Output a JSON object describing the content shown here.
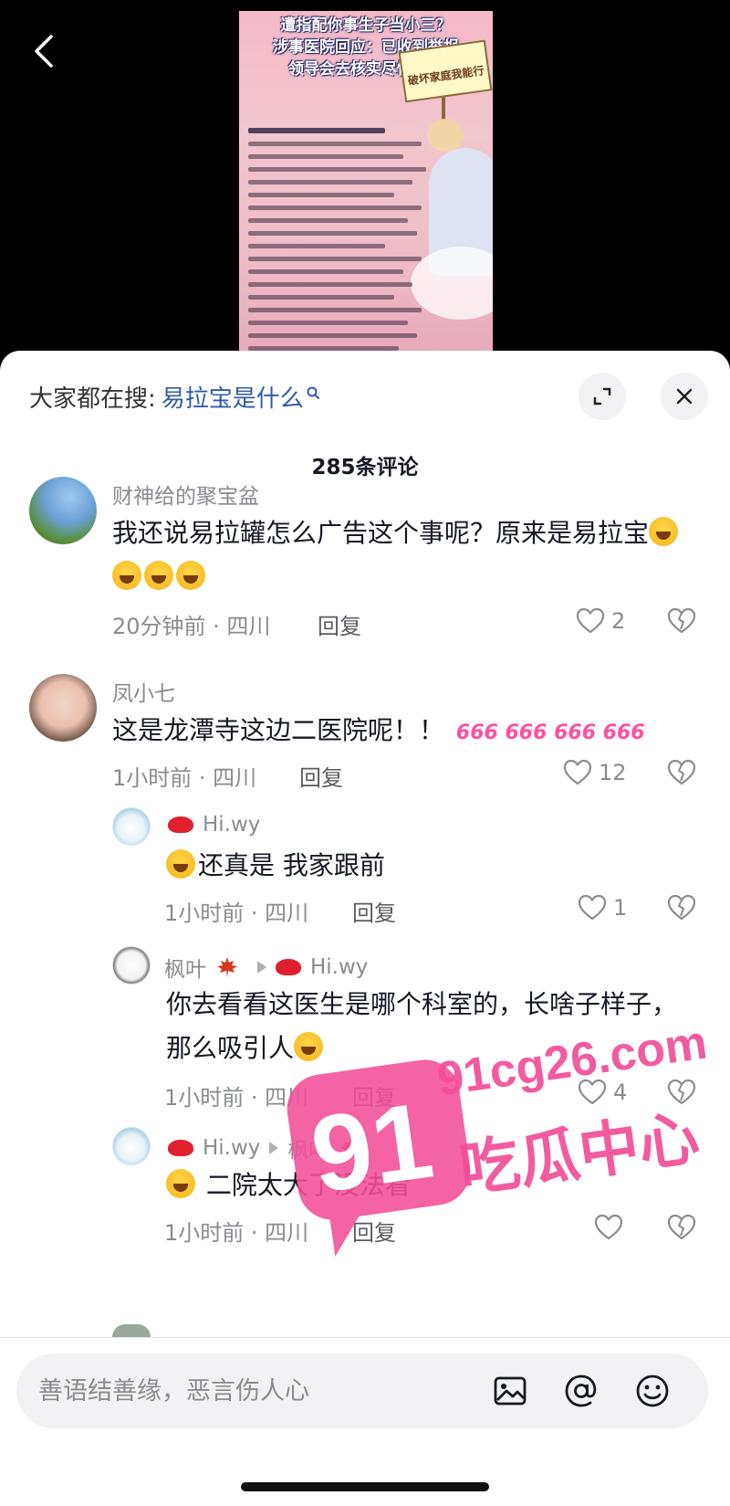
{
  "video": {
    "headline_lines": [
      "遭指配你事生子当小三？",
      "涉事医院回应：已收到举报",
      "领导会去核实尽快处理"
    ],
    "sign_text": "破坏家庭我能行"
  },
  "search_suggest": {
    "prefix": "大家都在搜:",
    "term": "易拉宝是什么"
  },
  "comment_count": "285条评论",
  "comments": [
    {
      "user": "财神给的聚宝盆",
      "text": "我还说易拉罐怎么广告这个事呢？原来是易拉宝",
      "time": "20分钟前 · 四川",
      "reply": "回复",
      "likes": "2"
    },
    {
      "user": "凤小七",
      "text": "这是龙潭寺这边二医院呢！！",
      "emoji_text": "666 666 666 666",
      "time": "1小时前 · 四川",
      "reply": "回复",
      "likes": "12"
    },
    {
      "user": "Hi.wy",
      "text": "还真是 我家跟前",
      "time": "1小时前 · 四川",
      "reply": "回复",
      "likes": "1"
    },
    {
      "user": "枫叶",
      "reply_to": "Hi.wy",
      "text": "你去看看这医生是哪个科室的，长啥子样子，那么吸引人",
      "time": "1小时前 · 四川",
      "reply": "回复",
      "likes": "4"
    },
    {
      "user": "Hi.wy",
      "reply_to": "枫叶",
      "text": "二院太大了没法看",
      "time": "1小时前 · 四川",
      "reply": "回复",
      "likes": ""
    }
  ],
  "watermark": {
    "big": "91",
    "domain": "91cg26.com",
    "cn": "吃瓜中心"
  },
  "input": {
    "placeholder": "善语结善缘，恶言伤人心"
  },
  "icons": [
    "back-icon",
    "expand-icon",
    "close-icon",
    "heart-icon",
    "dislike-icon",
    "image-icon",
    "at-icon",
    "emoji-icon"
  ],
  "colors": {
    "link_blue": "#2f5caa",
    "meta_gray": "#8a8b91",
    "watermark_pink": "#f34e97"
  }
}
